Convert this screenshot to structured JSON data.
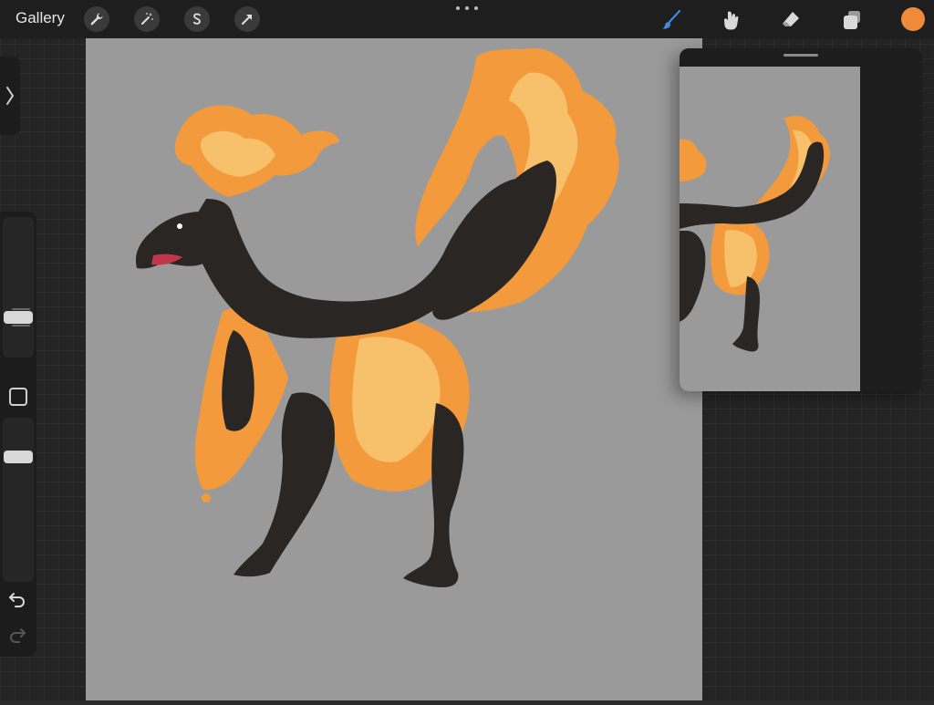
{
  "topbar": {
    "gallery_label": "Gallery",
    "left_tools": [
      "wrench-icon",
      "magic-wand-icon",
      "selection-icon",
      "transform-arrow-icon"
    ],
    "right_tools": [
      "brush-icon",
      "smudge-icon",
      "eraser-icon",
      "layers-icon"
    ],
    "active_tool": "brush-icon",
    "current_color": "#ee8a3a"
  },
  "colors": {
    "brush_active": "#3a8de0",
    "fire_orange": "#f39a3c",
    "fire_light": "#f7c06a",
    "creature_black": "#2a2624",
    "canvas_gray": "#9a9a9a"
  },
  "sidebar": {
    "brush_size_level": 0.25,
    "opacity_level": 0.8
  }
}
